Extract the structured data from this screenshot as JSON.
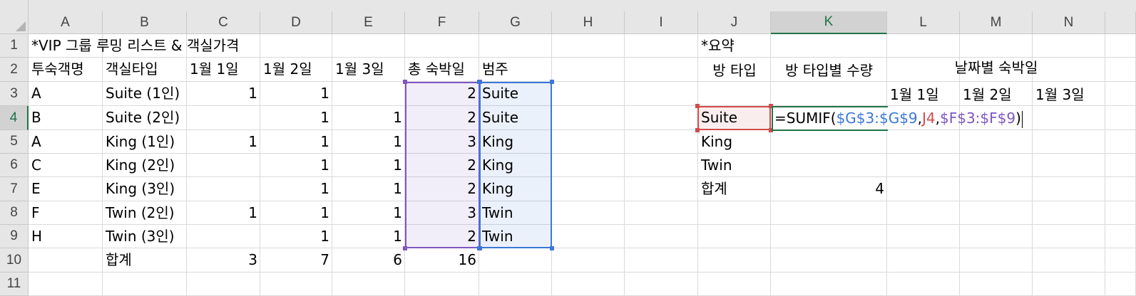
{
  "columns": [
    "A",
    "B",
    "C",
    "D",
    "E",
    "F",
    "G",
    "H",
    "I",
    "J",
    "K",
    "L",
    "M",
    "N"
  ],
  "rows": [
    "1",
    "2",
    "3",
    "4",
    "5",
    "6",
    "7",
    "8",
    "9",
    "10",
    "11"
  ],
  "active_cell": {
    "column": "K",
    "row": "4"
  },
  "cells": {
    "A1": "*VIP 그룹 루밍 리스트 & 객실가격",
    "A2": "투숙객명",
    "B2": "객실타입",
    "C2": "1월 1일",
    "D2": "1월 2일",
    "E2": "1월 3일",
    "F2": "총 숙박일",
    "G2": "범주",
    "A3": "A",
    "B3": "Suite (1인)",
    "C3": "1",
    "D3": "1",
    "E3": "",
    "F3": "2",
    "G3": "Suite",
    "A4": "B",
    "B4": "Suite (2인)",
    "C4": "",
    "D4": "1",
    "E4": "1",
    "F4": "2",
    "G4": "Suite",
    "A5": "A",
    "B5": "King (1인)",
    "C5": "1",
    "D5": "1",
    "E5": "1",
    "F5": "3",
    "G5": "King",
    "A6": "C",
    "B6": "King (2인)",
    "C6": "",
    "D6": "1",
    "E6": "1",
    "F6": "2",
    "G6": "King",
    "A7": "E",
    "B7": "King (3인)",
    "C7": "",
    "D7": "1",
    "E7": "1",
    "F7": "2",
    "G7": "King",
    "A8": "F",
    "B8": "Twin (2인)",
    "C8": "1",
    "D8": "1",
    "E8": "1",
    "F8": "3",
    "G8": "Twin",
    "A9": "H",
    "B9": "Twin (3인)",
    "C9": "",
    "D9": "1",
    "E9": "1",
    "F9": "2",
    "G9": "Twin",
    "B10": "합계",
    "C10": "3",
    "D10": "7",
    "E10": "6",
    "F10": "16",
    "J1": "*요약",
    "J2": "방 타입",
    "K2": "방 타입별 수량",
    "L2": "날짜별 숙박일",
    "L3": "1월 1일",
    "M3": "1월 2일",
    "N3": "1월 3일",
    "J4": "Suite",
    "J5": "King",
    "J6": "Twin",
    "J7": "합계",
    "K7": "4"
  },
  "formula": {
    "prefix": "=SUMIF(",
    "range": "$G$3:$G$9",
    "sep1": ",",
    "criteria": "J4",
    "sep2": ",",
    "sum_range": "$F$3:$F$9",
    "suffix": ")"
  },
  "colors": {
    "range_g": "#3b78d8",
    "range_j": "#d14b4b",
    "range_f": "#7e57c2",
    "active": "#217346"
  }
}
